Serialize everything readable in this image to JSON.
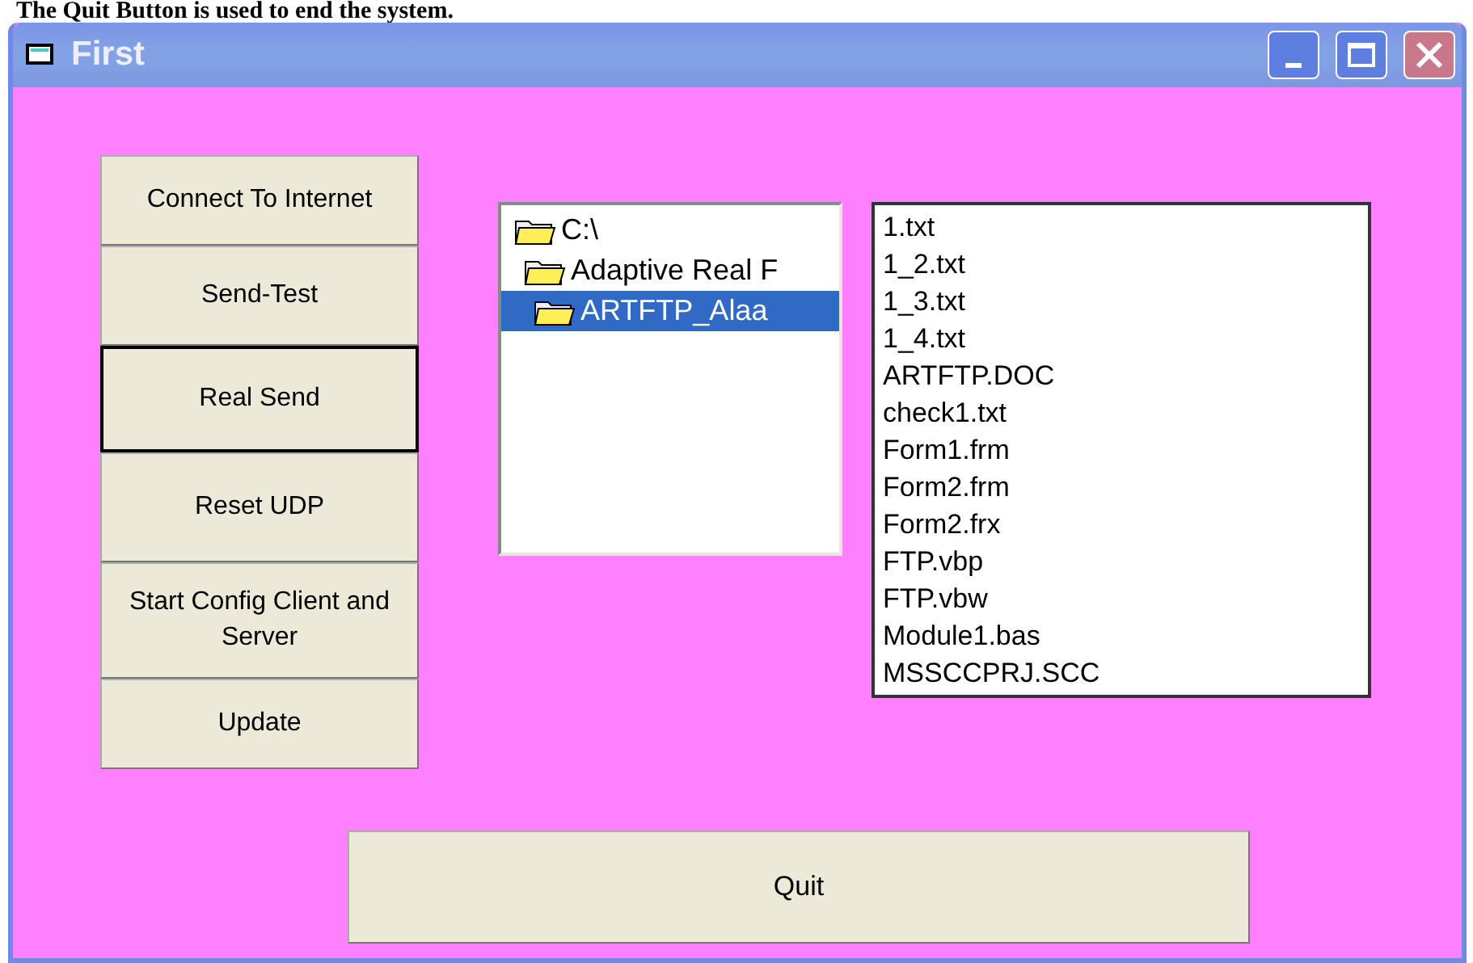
{
  "caption": "The Quit Button is used to end the system.",
  "window": {
    "title": "First",
    "controls": [
      {
        "kind": "minimize"
      },
      {
        "kind": "maximize"
      },
      {
        "kind": "close"
      }
    ]
  },
  "buttons": [
    {
      "label": "Connect To Internet",
      "focused": false
    },
    {
      "label": "Send-Test",
      "focused": false
    },
    {
      "label": "Real Send",
      "focused": true
    },
    {
      "label": "Reset UDP",
      "focused": false
    },
    {
      "label": "Start Config Client and Server",
      "focused": false
    },
    {
      "label": "Update",
      "focused": false
    }
  ],
  "folders": [
    {
      "name": "C:\\",
      "selected": false,
      "children": [
        {
          "name": "Adaptive Real F",
          "selected": false,
          "children": [
            {
              "name": "ARTFTP_Alaa",
              "selected": true
            }
          ]
        }
      ]
    }
  ],
  "files": [
    "1.txt",
    "1_2.txt",
    "1_3.txt",
    "1_4.txt",
    "ARTFTP.DOC",
    "check1.txt",
    "Form1.frm",
    "Form2.frm",
    "Form2.frx",
    "FTP.vbp",
    "FTP.vbw",
    "Module1.bas",
    "MSSCCPRJ.SCC"
  ],
  "quit": {
    "label": "Quit"
  }
}
